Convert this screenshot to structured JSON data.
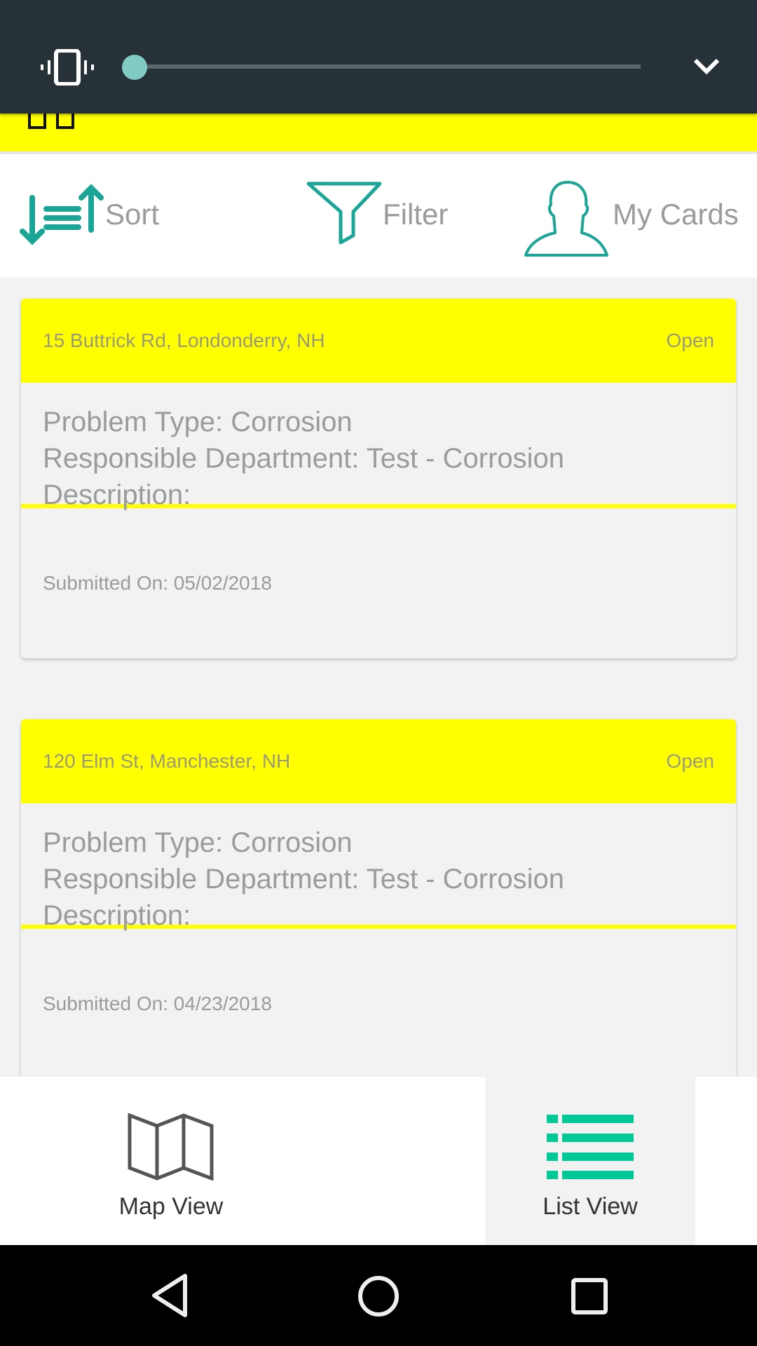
{
  "volume_panel": {
    "mode_icon": "vibrate-icon",
    "volume_level_percent": 0,
    "collapse_icon": "chevron-down-icon"
  },
  "topbar": {
    "icon": "grid-icon"
  },
  "toolbar": {
    "sort_label": "Sort",
    "filter_label": "Filter",
    "my_cards_label": "My Cards"
  },
  "cards": [
    {
      "address": "15 Buttrick Rd, Londonderry, NH",
      "status": "Open",
      "problem_type": "Problem Type: Corrosion",
      "department": "Responsible Department: Test - Corrosion",
      "description": "Description:",
      "submitted": "Submitted On: 05/02/2018"
    },
    {
      "address": "120 Elm St, Manchester, NH",
      "status": "Open",
      "problem_type": "Problem Type: Corrosion",
      "department": "Responsible Department: Test - Corrosion",
      "description": "Description:",
      "submitted": "Submitted On: 04/23/2018"
    }
  ],
  "bottom_nav": {
    "map_label": "Map View",
    "list_label": "List View",
    "active": "List View"
  },
  "colors": {
    "accent_teal": "#1aa596",
    "active_green": "#00c896",
    "card_yellow": "#ffff00",
    "volume_panel_bg": "#263238"
  }
}
